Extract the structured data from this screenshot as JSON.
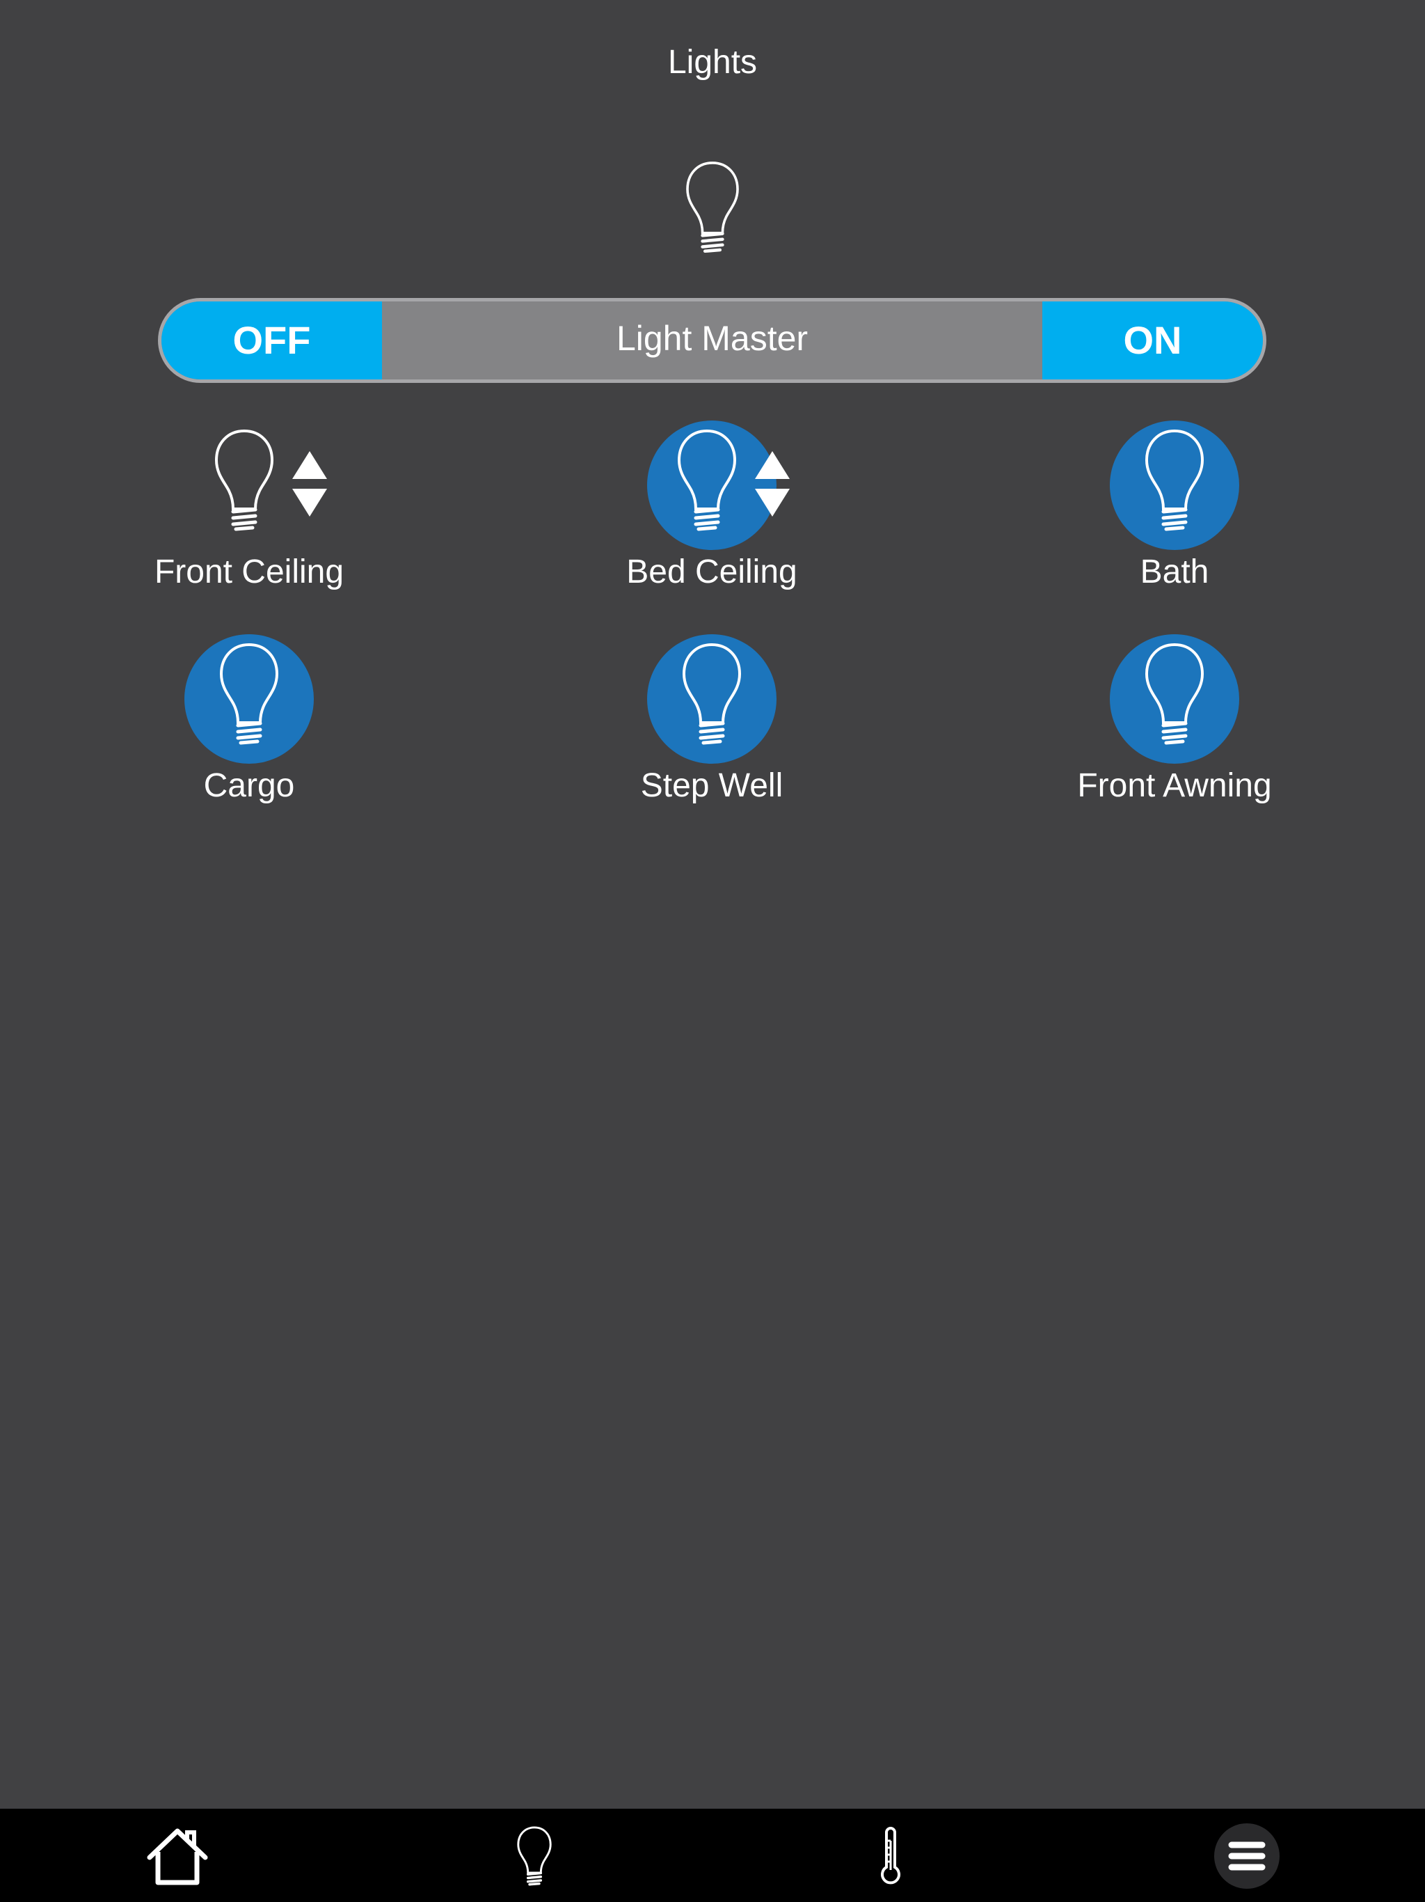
{
  "header": {
    "title": "Lights"
  },
  "master": {
    "off_label": "OFF",
    "title": "Light Master",
    "on_label": "ON"
  },
  "lights": [
    {
      "label": "Front Ceiling",
      "state": "off",
      "dimmable": true
    },
    {
      "label": "Bed Ceiling",
      "state": "on",
      "dimmable": true
    },
    {
      "label": "Bath",
      "state": "on",
      "dimmable": false
    },
    {
      "label": "Cargo",
      "state": "on",
      "dimmable": false
    },
    {
      "label": "Step Well",
      "state": "on",
      "dimmable": false
    },
    {
      "label": "Front Awning",
      "state": "on",
      "dimmable": false
    }
  ],
  "nav": {
    "items": [
      {
        "icon": "home-icon"
      },
      {
        "icon": "lightbulb-icon"
      },
      {
        "icon": "thermometer-icon"
      },
      {
        "icon": "menu-icon"
      }
    ]
  },
  "colors": {
    "background": "#414143",
    "accent": "#00aeef",
    "light_on": "#1c75bc",
    "master_track": "#848486",
    "nav_bar": "#000000"
  }
}
